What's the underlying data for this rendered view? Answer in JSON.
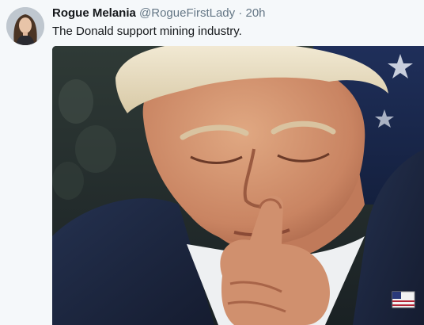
{
  "tweet": {
    "author_name": "Rogue Melania",
    "handle": "@RogueFirstLady",
    "separator": "·",
    "time": "20h",
    "text": "The Donald support mining industry.",
    "avatar_icon": "profile-photo-icon"
  },
  "colors": {
    "background": "#f5f8fa",
    "name_text": "#14171a",
    "secondary_text": "#657786"
  }
}
